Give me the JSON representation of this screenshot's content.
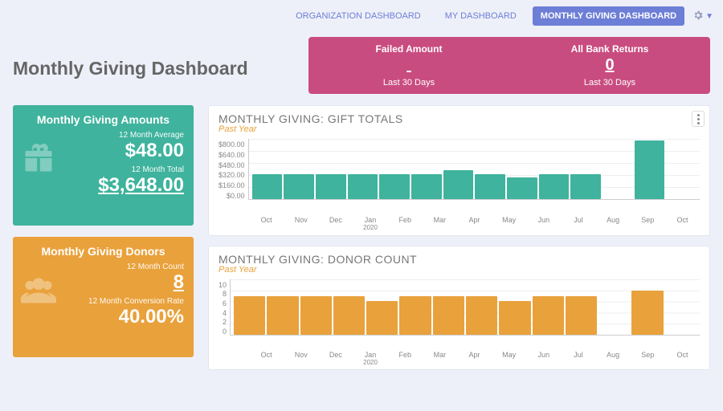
{
  "nav": {
    "org": "ORGANIZATION DASHBOARD",
    "my": "MY DASHBOARD",
    "monthly": "MONTHLY GIVING DASHBOARD"
  },
  "page_title": "Monthly Giving Dashboard",
  "alert": {
    "failed_label": "Failed Amount",
    "failed_sub": "Last 30 Days",
    "returns_label": "All Bank Returns",
    "returns_value": "0",
    "returns_sub": "Last 30 Days"
  },
  "amounts_card": {
    "title": "Monthly Giving Amounts",
    "avg_label": "12 Month Average",
    "avg_value": "$48.00",
    "total_label": "12 Month Total",
    "total_value": "$3,648.00"
  },
  "donors_card": {
    "title": "Monthly Giving Donors",
    "count_label": "12 Month Count",
    "count_value": "8",
    "rate_label": "12 Month Conversion Rate",
    "rate_value": "40.00%"
  },
  "gift_panel": {
    "title": "MONTHLY GIVING: GIFT TOTALS",
    "subtitle": "Past Year"
  },
  "donor_panel": {
    "title": "MONTHLY GIVING: DONOR COUNT",
    "subtitle": "Past Year"
  },
  "chart_data": [
    {
      "type": "bar",
      "title": "MONTHLY GIVING: GIFT TOTALS",
      "subtitle": "Past Year",
      "ylabel": "",
      "xlabel": "",
      "ylim": [
        0,
        800
      ],
      "yticks": [
        "$800.00",
        "$640.00",
        "$480.00",
        "$320.00",
        "$160.00",
        "$0.00"
      ],
      "categories": [
        "Oct",
        "Nov",
        "Dec",
        "Jan 2020",
        "Feb",
        "Mar",
        "Apr",
        "May",
        "Jun",
        "Jul",
        "Aug",
        "Sep",
        "Oct"
      ],
      "values": [
        336,
        336,
        336,
        336,
        336,
        336,
        384,
        336,
        288,
        336,
        336,
        0,
        784,
        0
      ],
      "color": "#3fb39d"
    },
    {
      "type": "bar",
      "title": "MONTHLY GIVING: DONOR COUNT",
      "subtitle": "Past Year",
      "ylabel": "",
      "xlabel": "",
      "ylim": [
        0,
        10
      ],
      "yticks": [
        "10",
        "8",
        "6",
        "4",
        "2",
        "0"
      ],
      "categories": [
        "Oct",
        "Nov",
        "Dec",
        "Jan 2020",
        "Feb",
        "Mar",
        "Apr",
        "May",
        "Jun",
        "Jul",
        "Aug",
        "Sep",
        "Oct"
      ],
      "values": [
        7,
        7,
        7,
        7,
        6,
        7,
        7,
        7,
        6,
        7,
        7,
        0,
        8,
        0
      ],
      "color": "#e9a13b"
    }
  ]
}
